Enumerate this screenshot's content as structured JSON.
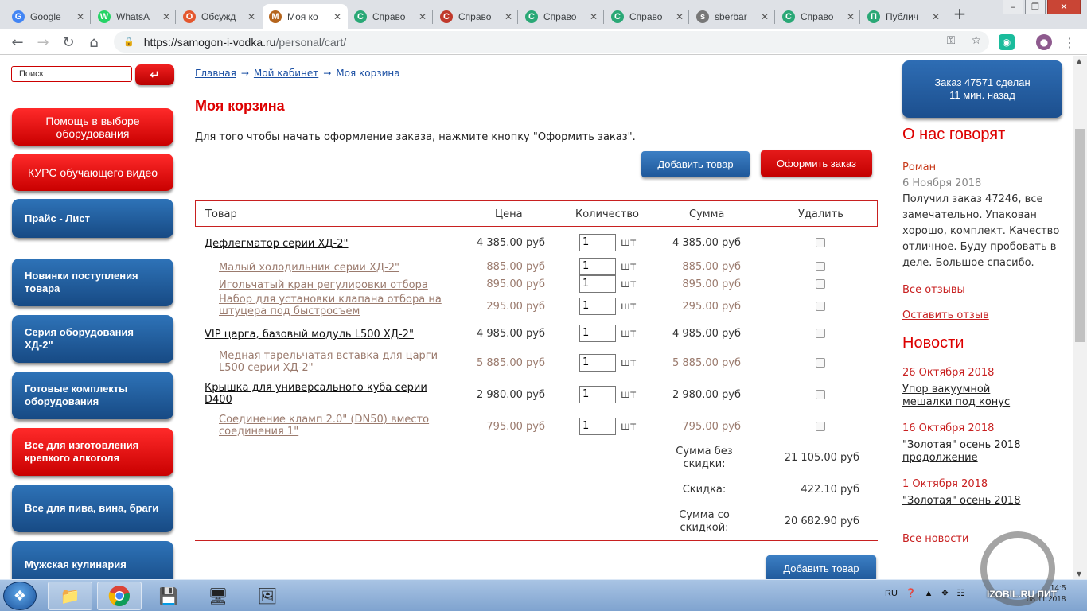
{
  "browser": {
    "tabs": [
      {
        "label": "Google",
        "icon": "G",
        "icon_color": "#4285f4"
      },
      {
        "label": "WhatsA",
        "icon": "W",
        "icon_color": "#25d366"
      },
      {
        "label": "Обсужд",
        "icon": "О",
        "icon_color": "#e4572e"
      },
      {
        "label": "Моя ко",
        "icon": "М",
        "icon_color": "#b5651d"
      },
      {
        "label": "Справо",
        "icon": "С",
        "icon_color": "#2aa876"
      },
      {
        "label": "Справо",
        "icon": "С",
        "icon_color": "#c0392b"
      },
      {
        "label": "Справо",
        "icon": "С",
        "icon_color": "#2aa876"
      },
      {
        "label": "Справо",
        "icon": "С",
        "icon_color": "#2aa876"
      },
      {
        "label": "sberbar",
        "icon": "s",
        "icon_color": "#777777"
      },
      {
        "label": "Справо",
        "icon": "С",
        "icon_color": "#2aa876"
      },
      {
        "label": "Публич",
        "icon": "П",
        "icon_color": "#2aa876"
      }
    ],
    "url_domain": "https://samogon-i-vodka.ru",
    "url_path": "/personal/cart/"
  },
  "search": {
    "placeholder": "Поиск"
  },
  "left_menu": [
    {
      "label": "Помощь в выборе оборудования",
      "style": "red"
    },
    {
      "label": "КУРС обучающего видео",
      "style": "red"
    },
    {
      "label": "Прайс - Лист",
      "style": "blue"
    },
    {
      "label": "Новинки поступления товара",
      "style": "blue"
    },
    {
      "label": "Серия оборудования ХД-2\"",
      "style": "blue"
    },
    {
      "label": "Готовые комплекты оборудования",
      "style": "blue"
    },
    {
      "label": "Все для изготовления крепкого алкоголя",
      "style": "red"
    },
    {
      "label": "Все для пива, вина, браги",
      "style": "blue"
    },
    {
      "label": "Мужская кулинария",
      "style": "blue"
    }
  ],
  "breadcrumb": {
    "home": "Главная",
    "cabinet": "Мой кабинет",
    "current": "Моя корзина",
    "separator": "→"
  },
  "cart": {
    "title": "Моя корзина",
    "intro": "Для того чтобы начать оформление заказа, нажмите кнопку \"Оформить заказ\".",
    "add_button": "Добавить товар",
    "checkout_button": "Оформить заказ",
    "headers": {
      "product": "Товар",
      "price": "Цена",
      "qty": "Количество",
      "sum": "Сумма",
      "delete": "Удалить"
    },
    "items": [
      {
        "name": "Дефлегматор серии ХД-2\"",
        "price": "4 385.00 руб",
        "qty": "1",
        "unit": "шт",
        "sum": "4 385.00 руб",
        "sub": false
      },
      {
        "name": "Малый холодильник серии ХД-2\"",
        "price": "885.00 руб",
        "qty": "1",
        "unit": "шт",
        "sum": "885.00 руб",
        "sub": true
      },
      {
        "name": "Игольчатый кран регулировки отбора",
        "price": "895.00 руб",
        "qty": "1",
        "unit": "шт",
        "sum": "895.00 руб",
        "sub": true
      },
      {
        "name": "Набор для установки клапана отбора на штуцера под быстросъем",
        "price": "295.00 руб",
        "qty": "1",
        "unit": "шт",
        "sum": "295.00 руб",
        "sub": true
      },
      {
        "name": "VIP царга, базовый модуль L500 ХД-2\"",
        "price": "4 985.00 руб",
        "qty": "1",
        "unit": "шт",
        "sum": "4 985.00 руб",
        "sub": false
      },
      {
        "name": "Медная тарельчатая вставка для царги L500 серии ХД-2\"",
        "price": "5 885.00 руб",
        "qty": "1",
        "unit": "шт",
        "sum": "5 885.00 руб",
        "sub": true
      },
      {
        "name": "Крышка для универсального куба серии D400",
        "price": "2 980.00 руб",
        "qty": "1",
        "unit": "шт",
        "sum": "2 980.00 руб",
        "sub": false
      },
      {
        "name": "Соединение кламп 2.0\" (DN50) вместо соединения 1\"",
        "price": "795.00 руб",
        "qty": "1",
        "unit": "шт",
        "sum": "795.00 руб",
        "sub": true
      }
    ],
    "totals": {
      "subtotal_label": "Сумма без скидки:",
      "subtotal": "21 105.00 руб",
      "discount_label": "Скидка:",
      "discount": "422.10 руб",
      "total_label": "Сумма со скидкой:",
      "total": "20 682.90 руб"
    }
  },
  "sidebar_right": {
    "order_notice_line1": "Заказ 47571 сделан",
    "order_notice_line2": "11 мин. назад",
    "reviews_title": "О нас говорят",
    "review": {
      "author": "Роман",
      "date": "6 Ноября 2018",
      "text": "Получил заказ 47246, все замечательно. Упакован хорошо, комплект. Качество отличное. Буду пробовать в деле. Большое спасибо."
    },
    "all_reviews": "Все отзывы",
    "leave_review": "Оставить отзыв",
    "news_title": "Новости",
    "news": [
      {
        "date": "26 Октября 2018",
        "title": "Упор вакуумной мешалки под конус"
      },
      {
        "date": "16 Октября 2018",
        "title": "\"Золотая\" осень 2018 продолжение"
      },
      {
        "date": "1 Октября 2018",
        "title": "\"Золотая\" осень 2018"
      }
    ],
    "all_news": "Все новости"
  },
  "taskbar": {
    "lang": "RU",
    "time": "14:5",
    "date": "08.11.2018"
  },
  "watermark": "IZOBIL.RU ПИТ"
}
